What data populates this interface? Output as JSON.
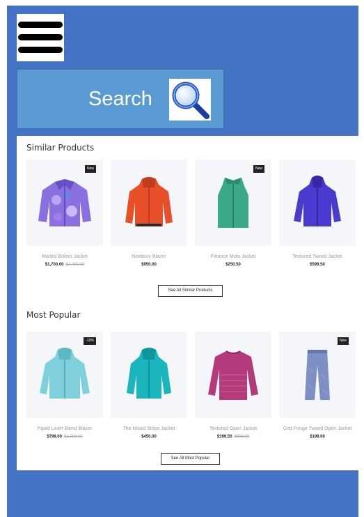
{
  "header": {
    "menu_icon": "hamburger-menu-icon",
    "search": {
      "label": "Search",
      "icon": "magnifying-glass-icon"
    }
  },
  "colors": {
    "frame": "#4472c4",
    "search_box": "#5b9bd5",
    "badge": "#222222"
  },
  "similar": {
    "title": "Similar Products",
    "button": "See All Similar Products",
    "items": [
      {
        "name": "Marled Bolero Jacket",
        "price": "$1,700.00",
        "old_price": "$2,499.00",
        "badge": "New"
      },
      {
        "name": "Newbury Blazer",
        "price": "$950.00",
        "old_price": "",
        "badge": ""
      },
      {
        "name": "Flounce Moto Jacket",
        "price": "$250.50",
        "old_price": "",
        "badge": "New"
      },
      {
        "name": "Textured Tweed Jacket",
        "price": "$599.50",
        "old_price": "",
        "badge": ""
      }
    ]
  },
  "popular": {
    "title": "Most Popular",
    "button": "See All Most Popular",
    "items": [
      {
        "name": "Piped Linen Blend Blazer",
        "price": "$799.00",
        "old_price": "$1,299.00",
        "badge": "-10%"
      },
      {
        "name": "The Mixed Stripe Jacket",
        "price": "$450.00",
        "old_price": "",
        "badge": ""
      },
      {
        "name": "Textured Open Jacket",
        "price": "$399.50",
        "old_price": "$699.00",
        "badge": ""
      },
      {
        "name": "Grid Fringe Tweed Open Jacket",
        "price": "$199.00",
        "old_price": "",
        "badge": "New"
      }
    ]
  }
}
